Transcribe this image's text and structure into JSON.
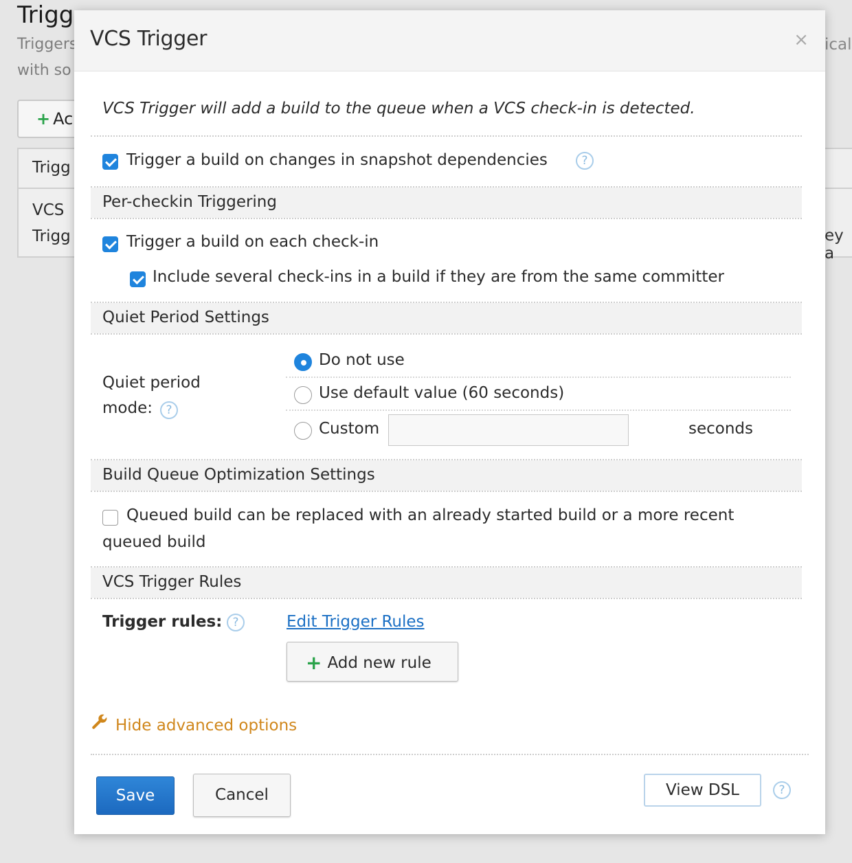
{
  "background": {
    "title": "Trigg",
    "text_line1": "Triggers",
    "text_line2": "with so",
    "add_button_label": "Ac",
    "table_header": "Trigg",
    "row_cell_line1": "VCS",
    "row_cell_line2": "Trigg",
    "right_text_top": "ical",
    "right_text_row": "ey a"
  },
  "dialog": {
    "title": "VCS Trigger",
    "close_symbol": "×",
    "intro": "VCS Trigger will add a build to the queue when a VCS check-in is detected.",
    "snapshot_deps": {
      "label": "Trigger a build on changes in snapshot dependencies",
      "checked": true
    },
    "sections": {
      "per_checkin": "Per-checkin Triggering",
      "quiet_period": "Quiet Period Settings",
      "queue_optimization": "Build Queue Optimization Settings",
      "trigger_rules": "VCS Trigger Rules"
    },
    "per_checkin": {
      "each_checkin": {
        "label": "Trigger a build on each check-in",
        "checked": true
      },
      "same_committer": {
        "label": "Include several check-ins in a build if they are from the same committer",
        "checked": true
      }
    },
    "quiet_period": {
      "mode_label_line1": "Quiet period",
      "mode_label_line2": "mode:",
      "options": [
        {
          "label": "Do not use",
          "selected": true
        },
        {
          "label": "Use default value (60 seconds)",
          "selected": false
        },
        {
          "label": "Custom",
          "selected": false
        }
      ],
      "custom_value": "",
      "custom_unit": "seconds"
    },
    "queue_optimization": {
      "label_line1": "Queued build can be replaced with an already started build or a more recent",
      "label_line2": "queued build",
      "checked": false
    },
    "trigger_rules": {
      "label": "Trigger rules:",
      "edit_link": "Edit Trigger Rules",
      "add_rule_button": "Add new rule"
    },
    "advanced_toggle": "Hide advanced options",
    "footer": {
      "save": "Save",
      "cancel": "Cancel",
      "view_dsl": "View DSL"
    },
    "help_icon_glyph": "?"
  },
  "colors": {
    "accent_blue": "#1f84dd",
    "link_blue": "#1a6fc4",
    "advanced_orange": "#d0871c",
    "plus_green": "#2aa34a"
  }
}
